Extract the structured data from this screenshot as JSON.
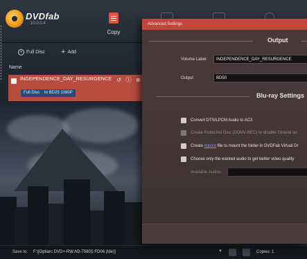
{
  "app": {
    "logo_text": "DVDfab",
    "version": "10.0.0.4"
  },
  "modes": {
    "copy_label": "Copy"
  },
  "toolbar": {
    "full_disc_label": "Full Disc",
    "add_label": "Add"
  },
  "list": {
    "name_header": "Name",
    "row": {
      "title": "INDEPENDENCE_DAY_RESURGENCE",
      "mode_pill": "Full Disc",
      "target_pill": "to BD25 1080P"
    }
  },
  "dialog": {
    "title": "Advanced Settings",
    "output_section": "Output",
    "volume_label_label": "Volume Label:",
    "volume_label_value": "INDEPENDENCE_DAY_RESURGENCE",
    "output_label": "Output",
    "output_value": "BD50",
    "bluray_section": "Blu-ray Settings",
    "options": [
      {
        "text": "Convert DTS/LPCM Audio to AC3",
        "enabled": true
      },
      {
        "text": "Create Protected Disc (DDMV-REC) to disable Cinavia on",
        "enabled": false
      },
      {
        "pre": "Create ",
        "link": "minico",
        "post": " file to mount the folder in DVDFab Virtual Dr",
        "enabled": true
      },
      {
        "text": "Choose only the wanted audio to get better video quality",
        "enabled": true
      }
    ],
    "available_audios_label": "Available Audios:"
  },
  "bottom": {
    "save_to_label": "Save to:",
    "save_path": "F:\\[Optiarc DVD+-RW AD-7580S FD06 (Ide)]",
    "copies": "Copies: 1"
  },
  "colors": {
    "accent_red": "#c1463c",
    "row_red": "#b84c3e",
    "pill_blue": "#2a4d78",
    "link_blue": "#7aa7ff"
  }
}
